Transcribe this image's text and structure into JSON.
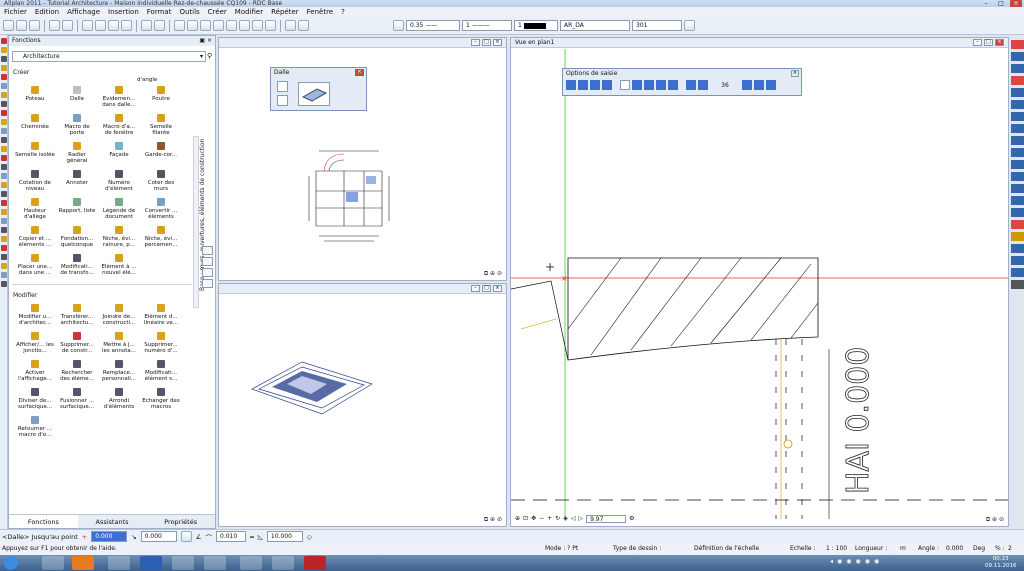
{
  "window": {
    "title": "Allplan 2011 - Tutorial Architecture - Maison individuelle Rez-de-chaussée CQ109 - RDC Base"
  },
  "menu": [
    "Fichier",
    "Edition",
    "Affichage",
    "Insertion",
    "Format",
    "Outils",
    "Créer",
    "Modifier",
    "Répéter",
    "Fenêtre",
    "?"
  ],
  "toolbar": {
    "pen": "0.35",
    "line": "1",
    "color": "1",
    "layer": "AR_DA",
    "pattern": "301"
  },
  "functions_panel": {
    "title": "Fonctions",
    "category": "Architecture",
    "create_label": "Créer",
    "create_items": [
      {
        "label": "Poteau",
        "color": "#d9a21b"
      },
      {
        "label": "Dalle",
        "color": "#c0c0c0"
      },
      {
        "label": "Evidemen... dans dalle...",
        "color": "#d9a21b"
      },
      {
        "label": "Poutre",
        "color": "#d9a21b"
      },
      {
        "label": "Cheminée",
        "color": "#d9a21b"
      },
      {
        "label": "Macro de porte",
        "color": "#7a9ec4"
      },
      {
        "label": "Macro d'a... de fenêtre",
        "color": "#d9a21b"
      },
      {
        "label": "Semelle filante",
        "color": "#d9a21b"
      },
      {
        "label": "Semelle isolée",
        "color": "#d9a21b"
      },
      {
        "label": "Radier général",
        "color": "#d9a21b"
      },
      {
        "label": "Façade",
        "color": "#7ab0d6"
      },
      {
        "label": "Garde-cor...",
        "color": "#8a5a2a"
      },
      {
        "label": "Cotation de niveau",
        "color": "#556"
      },
      {
        "label": "Annoter",
        "color": "#556"
      },
      {
        "label": "Numéro d'élément",
        "color": "#556"
      },
      {
        "label": "Coter des murs",
        "color": "#556"
      },
      {
        "label": "Hauteur d'allège",
        "color": "#d9a21b"
      },
      {
        "label": "Rapport, liste",
        "color": "#7a8"
      },
      {
        "label": "Légende de document",
        "color": "#7a8"
      },
      {
        "label": "Convertir ... éléments",
        "color": "#7a9ec4"
      },
      {
        "label": "Copier et ... éléments ...",
        "color": "#d9a21b"
      },
      {
        "label": "Fondation... quelconque",
        "color": "#d9a21b"
      },
      {
        "label": "Niche, évi... rainure, p...",
        "color": "#d9a21b"
      },
      {
        "label": "Niche, évi... percemen...",
        "color": "#d9a21b"
      },
      {
        "label": "Placer une... dans une ...",
        "color": "#d9a21b"
      },
      {
        "label": "Modificati... de transfo...",
        "color": "#556"
      },
      {
        "label": "Elément à ... nouvel élé...",
        "color": "#d9a21b"
      }
    ],
    "extra_label": "d'angle",
    "modify_label": "Modifier",
    "modify_items": [
      {
        "label": "Modifier u... d'architec...",
        "color": "#d9a21b"
      },
      {
        "label": "Transférer... architectu...",
        "color": "#d9a21b"
      },
      {
        "label": "Joindre de... constructi...",
        "color": "#d9a21b"
      },
      {
        "label": "Elément d... linéaire ve...",
        "color": "#d9a21b"
      },
      {
        "label": "Afficher/... les jonctio...",
        "color": "#d9a21b"
      },
      {
        "label": "Supprimer... de constr...",
        "color": "#c33"
      },
      {
        "label": "Mettre à j... les annota...",
        "color": "#d9a21b"
      },
      {
        "label": "Supprimer... numéro d'...",
        "color": "#d9a21b"
      },
      {
        "label": "Activer l'affichage...",
        "color": "#d9a21b"
      },
      {
        "label": "Rechercher des éléme...",
        "color": "#556"
      },
      {
        "label": "Remplace... personnali...",
        "color": "#556"
      },
      {
        "label": "Modificati... élément s...",
        "color": "#556"
      },
      {
        "label": "Diviser de... surfacique...",
        "color": "#556"
      },
      {
        "label": "Fusionner ... surfacique...",
        "color": "#556"
      },
      {
        "label": "Arrondi d'éléments",
        "color": "#556"
      },
      {
        "label": "Echanger des macros",
        "color": "#556"
      },
      {
        "label": "Retourner ... macro d'o...",
        "color": "#7a9ec4"
      }
    ],
    "vertical_label": "Base : murs, ouvertures, éléments de construction",
    "tabs": [
      "Fonctions",
      "Assistants",
      "Propriétés"
    ]
  },
  "dalle_dialog": {
    "title": "Dalle"
  },
  "plan_view": {
    "title": "Vue en plan1",
    "options_title": "Options de saisie",
    "options_value": "36",
    "elevation_text": "HAI 0.000",
    "scale_field": "9.97"
  },
  "command_line": {
    "prompt": "<Dalle> Jusqu'au point",
    "x_value": "0.000",
    "dx_value": "0.000",
    "angle_value": "0.010",
    "length_value": "10.000"
  },
  "status_bar": {
    "hint": "Appuyez sur F1 pour obtenir de l'aide.",
    "mode": "Mode : ? Pt",
    "drawing_type_label": "Type de dessin :",
    "drawing_type_value": "Définition de l'échelle",
    "scale_label": "Echelle :",
    "scale_value": "1 : 100",
    "length_label": "Longueur :",
    "length_unit": "m",
    "angle_label": "Angle :",
    "angle_value": "0.000",
    "angle_unit": "Deg",
    "percent_label": "% :",
    "percent_value": "2"
  },
  "taskbar": {
    "time": "00:23",
    "date": "09.11.2016"
  }
}
